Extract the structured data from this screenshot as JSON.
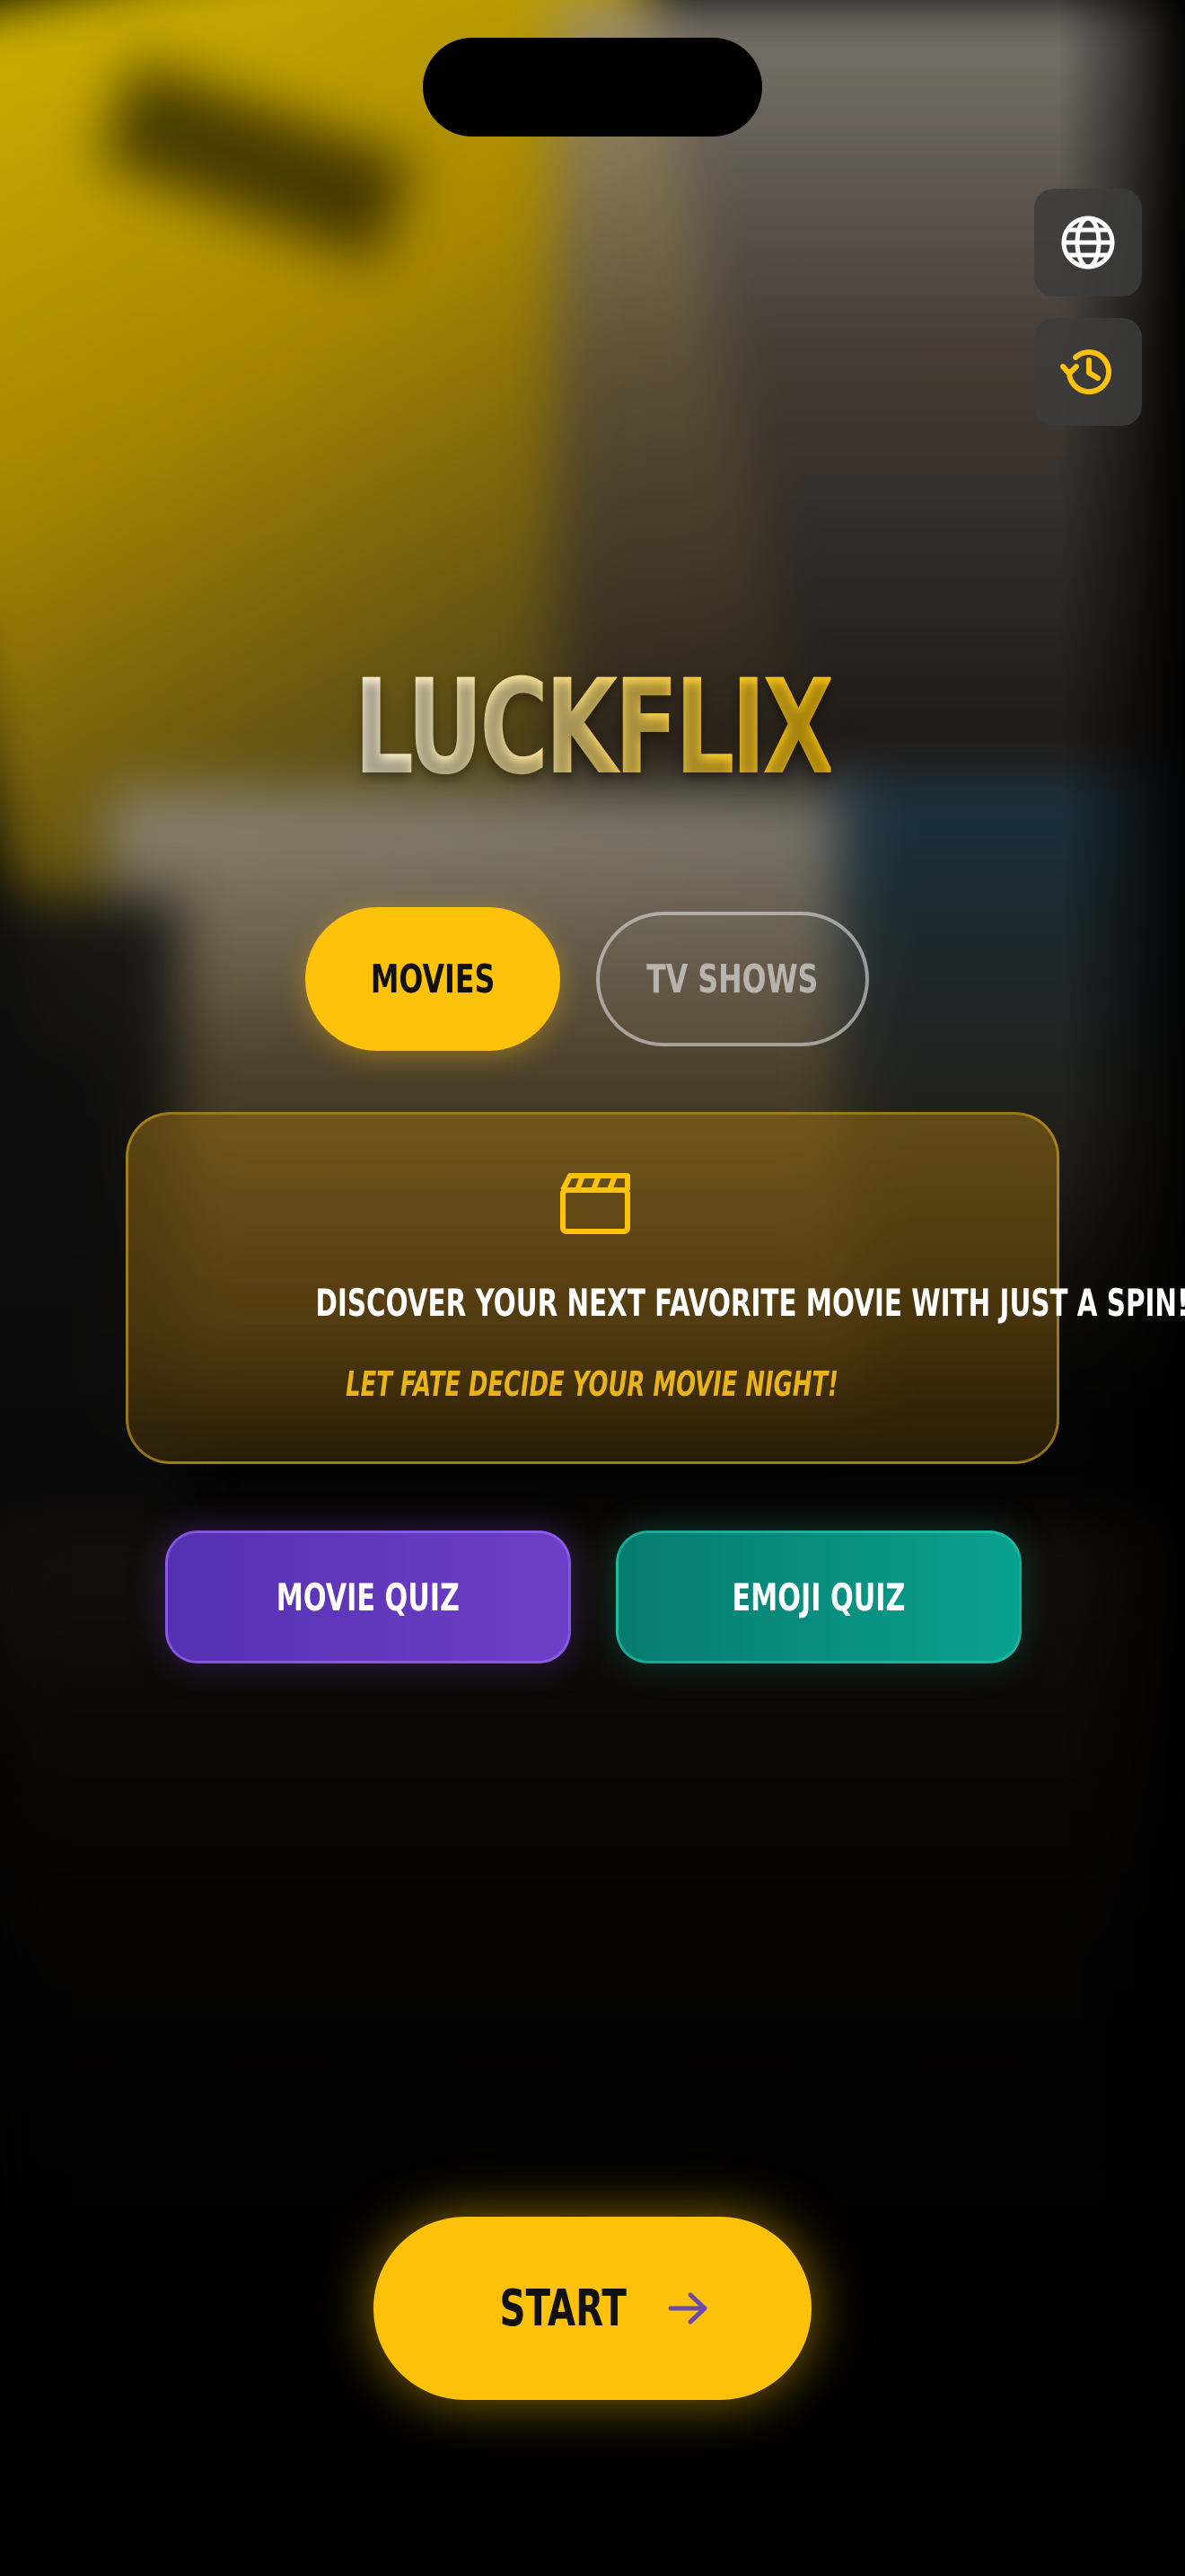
{
  "app": {
    "logo_text": "LUCKFLIX"
  },
  "side_buttons": {
    "language_icon": "globe-icon",
    "history_icon": "history-icon"
  },
  "mode_tabs": [
    {
      "label": "MOVIES",
      "selected": true
    },
    {
      "label": "TV SHOWS",
      "selected": false
    }
  ],
  "info_card": {
    "icon": "clapperboard-icon",
    "headline": "DISCOVER YOUR NEXT FAVORITE MOVIE WITH JUST A SPIN!",
    "subline": "LET FATE DECIDE YOUR MOVIE NIGHT!"
  },
  "quiz_buttons": {
    "movie_quiz": "MOVIE QUIZ",
    "emoji_quiz": "EMOJI QUIZ"
  },
  "start_button": {
    "label": "START",
    "icon": "arrow-right-icon"
  },
  "colors": {
    "accent_yellow": "#FFC20B",
    "movie_quiz_purple": "#6C3FC6",
    "emoji_quiz_teal": "#0AA08E"
  }
}
